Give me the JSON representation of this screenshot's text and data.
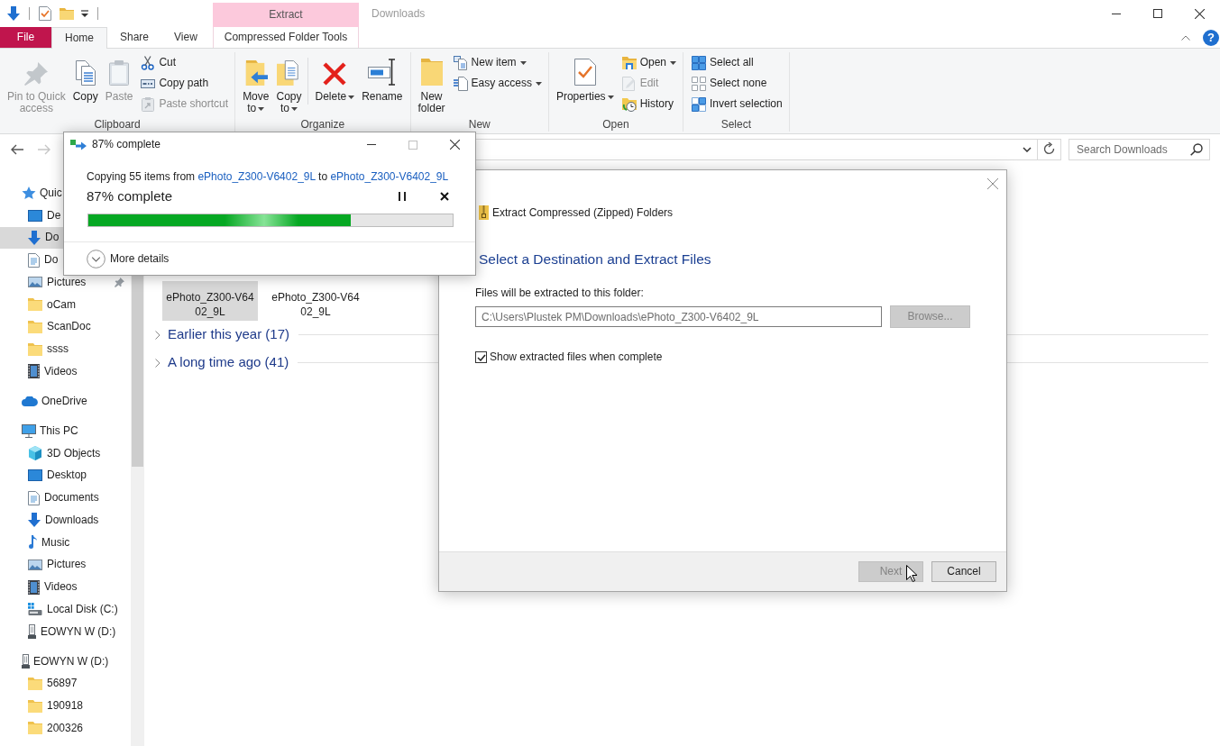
{
  "window": {
    "title": "Downloads",
    "context_group": "Extract"
  },
  "ribbon_tabs": [
    {
      "label": "File",
      "kind": "file",
      "selected": false
    },
    {
      "label": "Home",
      "kind": "tab",
      "selected": true
    },
    {
      "label": "Share",
      "kind": "tab",
      "selected": false
    },
    {
      "label": "View",
      "kind": "tab",
      "selected": false
    },
    {
      "label": "Compressed Folder Tools",
      "kind": "context",
      "selected": false
    }
  ],
  "help_button": {
    "label": "?"
  },
  "ribbon_groups": [
    {
      "label": "Clipboard",
      "large": [
        {
          "label": "Pin to Quick\naccess",
          "disabled": true,
          "dropdown": false
        },
        {
          "label": "Copy",
          "disabled": false,
          "dropdown": false
        },
        {
          "label": "Paste",
          "disabled": true,
          "dropdown": false
        }
      ],
      "small": [
        {
          "label": "Cut",
          "disabled": false,
          "dropdown": false
        },
        {
          "label": "Copy path",
          "disabled": false,
          "dropdown": false
        },
        {
          "label": "Paste shortcut",
          "disabled": true,
          "dropdown": false
        }
      ]
    },
    {
      "label": "Organize",
      "large": [
        {
          "label": "Move\nto",
          "disabled": false,
          "dropdown": true
        },
        {
          "label": "Copy\nto",
          "disabled": false,
          "dropdown": true
        },
        {
          "label": "Delete",
          "disabled": false,
          "dropdown": true,
          "separator": true
        },
        {
          "label": "Rename",
          "disabled": false,
          "dropdown": false
        }
      ]
    },
    {
      "label": "New",
      "large": [
        {
          "label": "New\nfolder",
          "disabled": false,
          "dropdown": false
        }
      ],
      "small": [
        {
          "label": "New item",
          "disabled": false,
          "dropdown": true
        },
        {
          "label": "Easy access",
          "disabled": false,
          "dropdown": true
        }
      ]
    },
    {
      "label": "Open",
      "large": [
        {
          "label": "Properties",
          "disabled": false,
          "dropdown": true
        }
      ],
      "small": [
        {
          "label": "Open",
          "disabled": false,
          "dropdown": true
        },
        {
          "label": "Edit",
          "disabled": true,
          "dropdown": false
        },
        {
          "label": "History",
          "disabled": false,
          "dropdown": false
        }
      ]
    },
    {
      "label": "Select",
      "small": [
        {
          "label": "Select all",
          "disabled": false,
          "dropdown": false
        },
        {
          "label": "Select none",
          "disabled": false,
          "dropdown": false
        },
        {
          "label": "Invert selection",
          "disabled": false,
          "dropdown": false
        }
      ]
    }
  ],
  "address_bar": {
    "back": {
      "disabled": false
    },
    "forward": {
      "disabled": true
    }
  },
  "search": {
    "placeholder": "Search Downloads"
  },
  "navigation": [
    {
      "label": "Quic",
      "kind": "quick",
      "selected": false,
      "children": [
        {
          "label": "De",
          "kind": "desktop",
          "selected": false,
          "pinned": false
        },
        {
          "label": "Do",
          "kind": "downloads",
          "selected": true,
          "pinned": false
        },
        {
          "label": "Do",
          "kind": "documents",
          "selected": false,
          "pinned": false
        },
        {
          "label": "Pictures",
          "kind": "pictures",
          "selected": false,
          "pinned": true
        },
        {
          "label": "oCam",
          "kind": "folder",
          "selected": false,
          "pinned": false
        },
        {
          "label": "ScanDoc",
          "kind": "folder",
          "selected": false,
          "pinned": false
        },
        {
          "label": "ssss",
          "kind": "folder",
          "selected": false,
          "pinned": false
        },
        {
          "label": "Videos",
          "kind": "videos",
          "selected": false,
          "pinned": false
        }
      ]
    },
    {
      "label": "OneDrive",
      "kind": "onedrive",
      "selected": false
    },
    {
      "label": "This PC",
      "kind": "thispc",
      "selected": false,
      "children": [
        {
          "label": "3D Objects",
          "kind": "objects3d",
          "selected": false
        },
        {
          "label": "Desktop",
          "kind": "desktop",
          "selected": false
        },
        {
          "label": "Documents",
          "kind": "documents",
          "selected": false
        },
        {
          "label": "Downloads",
          "kind": "downloads",
          "selected": false
        },
        {
          "label": "Music",
          "kind": "music",
          "selected": false
        },
        {
          "label": "Pictures",
          "kind": "pictures",
          "selected": false
        },
        {
          "label": "Videos",
          "kind": "videos",
          "selected": false
        },
        {
          "label": "Local Disk (C:)",
          "kind": "localdisk",
          "selected": false
        },
        {
          "label": "EOWYN W (D:)",
          "kind": "usbdrive",
          "selected": false
        }
      ]
    },
    {
      "label": "EOWYN W (D:)",
      "kind": "usbdrive",
      "selected": false,
      "children": [
        {
          "label": "56897",
          "kind": "folder",
          "selected": false
        },
        {
          "label": "190918",
          "kind": "folder",
          "selected": false
        },
        {
          "label": "200326",
          "kind": "folder",
          "selected": false
        }
      ]
    }
  ],
  "files": [
    {
      "name": "ePhoto_Z300-V6402_9L",
      "selected": true
    },
    {
      "name": "ePhoto_Z300-V6402_9L",
      "selected": false
    }
  ],
  "file_groups": [
    {
      "label": "Earlier this year (17)",
      "expanded": false
    },
    {
      "label": "A long time ago (41)",
      "expanded": false
    }
  ],
  "copy_dialog": {
    "title": "87% complete",
    "window_buttons": [
      {
        "kind": "minimize",
        "disabled": false
      },
      {
        "kind": "maximize",
        "disabled": true
      },
      {
        "kind": "close",
        "disabled": false
      }
    ],
    "message": [
      {
        "kind": "text",
        "text": "Copying 55 items from"
      },
      {
        "kind": "link",
        "text": "ePhoto_Z300-V6402_9L"
      },
      {
        "kind": "text",
        "text": "to"
      },
      {
        "kind": "link",
        "text": "ePhoto_Z300-V6402_9L"
      }
    ],
    "status": "87% complete",
    "level": 0.72,
    "more_details": "More details"
  },
  "extract_dialog": {
    "title": "Extract Compressed (Zipped) Folders",
    "heading": "Select a Destination and Extract Files",
    "folder_label": "Files will be extracted to this folder:",
    "folder_field": {
      "value": "C:\\Users\\Plustek PM\\Downloads\\ePhoto_Z300-V6402_9L",
      "disabled": true
    },
    "browse": {
      "label": "Browse...",
      "disabled": true
    },
    "show_files": {
      "label": "Show extracted files when complete",
      "checked": true
    },
    "buttons": [
      {
        "label": "Next",
        "disabled": true
      },
      {
        "label": "Cancel",
        "disabled": false
      }
    ]
  }
}
